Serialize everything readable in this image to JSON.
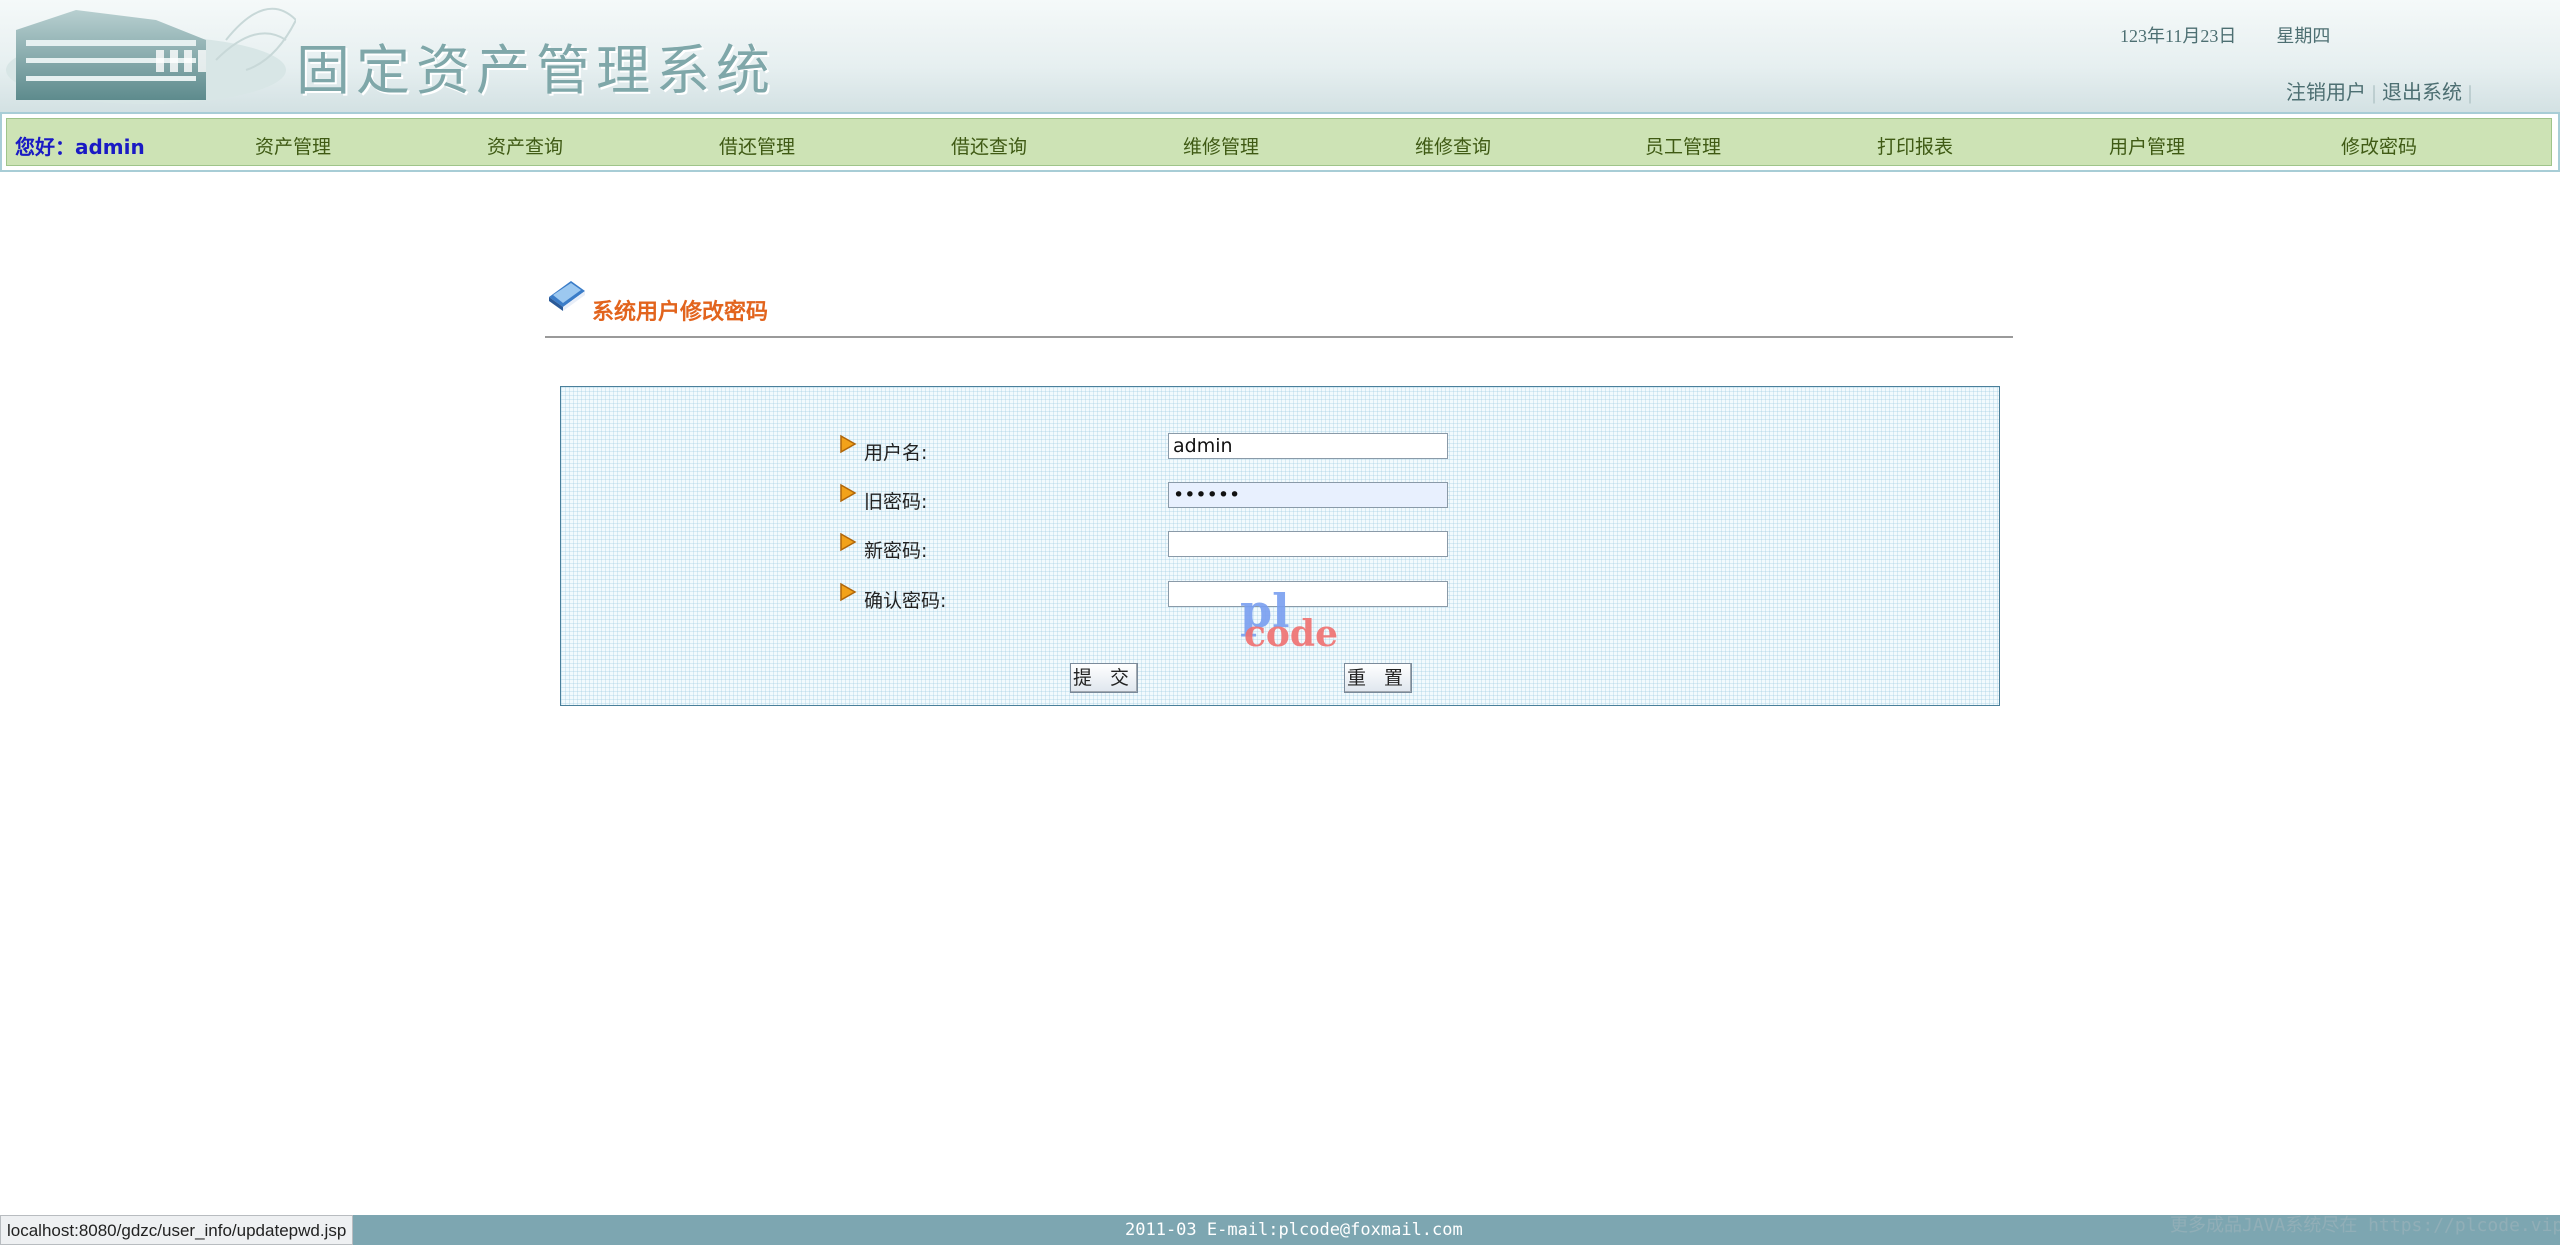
{
  "header": {
    "title": "固定资产管理系统",
    "date": "123年11月23日",
    "weekday": "星期四",
    "links": [
      "注销用户",
      "退出系统"
    ]
  },
  "nav": {
    "greeting": "您好：admin",
    "items": [
      "资产管理",
      "资产查询",
      "借还管理",
      "借还查询",
      "维修管理",
      "维修查询",
      "员工管理",
      "打印报表",
      "用户管理",
      "修改密码"
    ]
  },
  "section": {
    "title": "系统用户修改密码"
  },
  "form": {
    "username_label": "用户名:",
    "username_value": "admin",
    "old_password_label": "旧密码:",
    "old_password_value": "••••••",
    "new_password_label": "新密码:",
    "confirm_password_label": "确认密码:",
    "submit_label": "提 交",
    "reset_label": "重 置",
    "watermark_top": "pl",
    "watermark_bottom": "code"
  },
  "footer": {
    "text": "2011-03 E-mail:plcode@foxmail.com",
    "right_text": "更多成品JAVA系统尽在 https://plcode.vip"
  },
  "status_bar": {
    "url": "localhost:8080/gdzc/user_info/updatepwd.jsp"
  },
  "colors": {
    "nav_bg": "#cde3b5",
    "title_orange": "#e2641d",
    "footer_bg": "#7da6b1",
    "greeting_blue": "#1a1ac4"
  }
}
